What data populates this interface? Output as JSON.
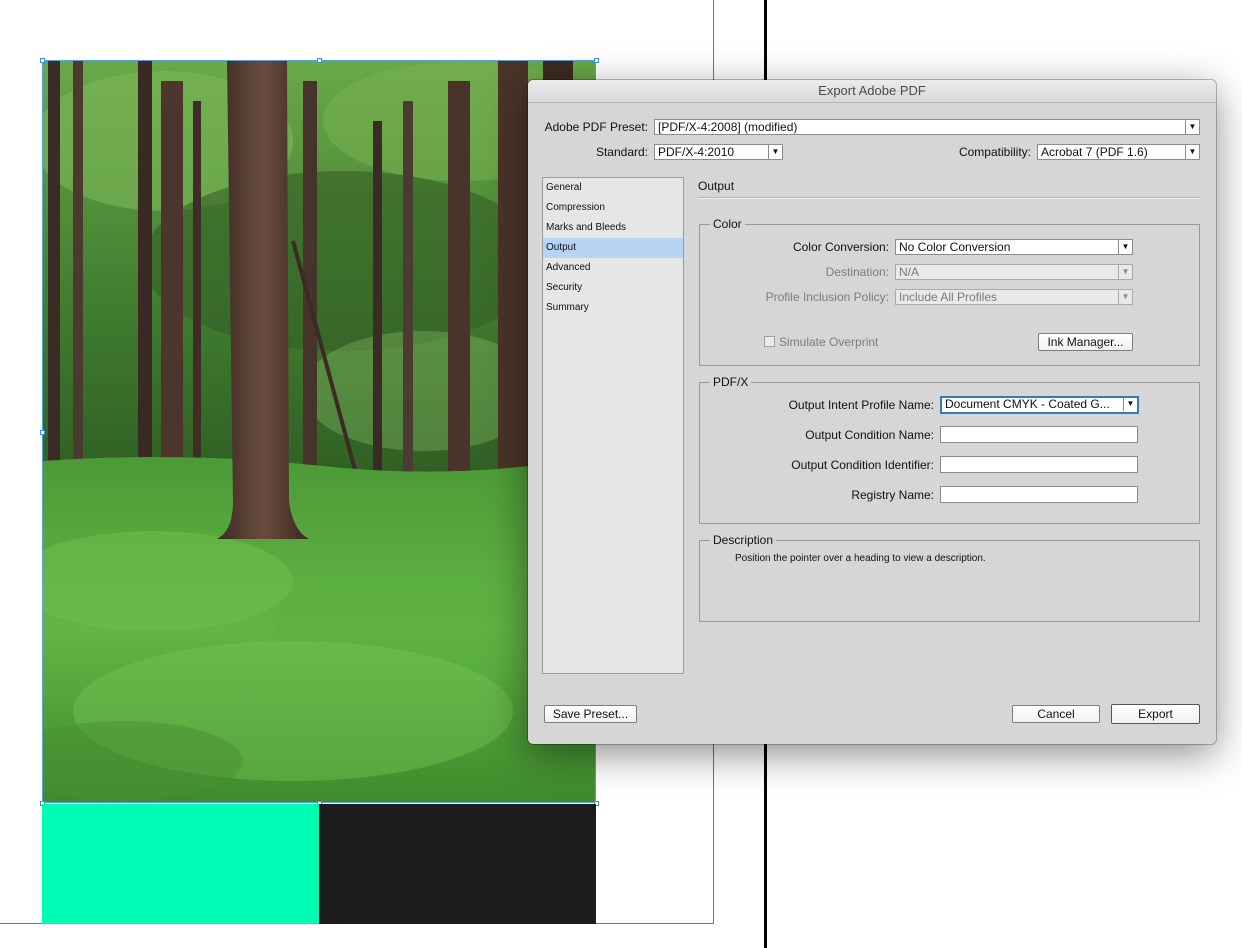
{
  "dialog": {
    "title": "Export Adobe PDF",
    "preset": {
      "label": "Adobe PDF Preset:",
      "value": "[PDF/X-4:2008] (modified)"
    },
    "standard": {
      "label": "Standard:",
      "value": "PDF/X-4:2010"
    },
    "compatibility": {
      "label": "Compatibility:",
      "value": "Acrobat 7 (PDF 1.6)"
    },
    "sidebar": {
      "items": [
        "General",
        "Compression",
        "Marks and Bleeds",
        "Output",
        "Advanced",
        "Security",
        "Summary"
      ],
      "selected": "Output"
    },
    "section_title": "Output",
    "color_group": {
      "title": "Color",
      "color_conversion": {
        "label": "Color Conversion:",
        "value": "No Color Conversion"
      },
      "destination": {
        "label": "Destination:",
        "value": "N/A"
      },
      "profile_policy": {
        "label": "Profile Inclusion Policy:",
        "value": "Include All Profiles"
      },
      "simulate_overprint": {
        "label": "Simulate Overprint",
        "checked": false
      },
      "ink_manager_label": "Ink Manager..."
    },
    "pdfx_group": {
      "title": "PDF/X",
      "output_intent": {
        "label": "Output Intent Profile Name:",
        "value": "Document CMYK - Coated G..."
      },
      "output_condition_name": {
        "label": "Output Condition Name:",
        "value": ""
      },
      "output_condition_identifier": {
        "label": "Output Condition Identifier:",
        "value": ""
      },
      "registry_name": {
        "label": "Registry Name:",
        "value": ""
      }
    },
    "description_group": {
      "title": "Description",
      "text": "Position the pointer over a heading to view a description."
    },
    "buttons": {
      "save_preset": "Save Preset...",
      "cancel": "Cancel",
      "export": "Export"
    }
  },
  "colors": {
    "selection_highlight": "#b7d3f6",
    "frame_selection": "#3a8ee6",
    "page_edge": "#c040c0",
    "swatch_green": "#00fcb4",
    "swatch_dark": "#1c1c1c"
  }
}
